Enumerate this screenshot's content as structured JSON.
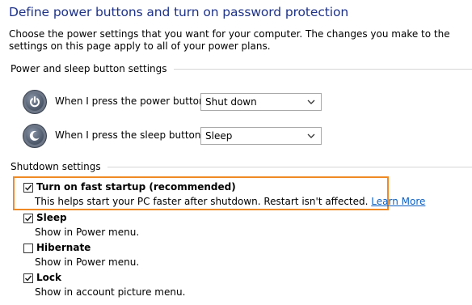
{
  "page": {
    "title": "Define power buttons and turn on password protection",
    "intro": "Choose the power settings that you want for your computer. The changes you make to the settings on this page apply to all of your power plans."
  },
  "power_section": {
    "header": "Power and sleep button settings",
    "rows": [
      {
        "label": "When I press the power button:",
        "value": "Shut down",
        "icon": "power-button-icon"
      },
      {
        "label": "When I press the sleep button:",
        "value": "Sleep",
        "icon": "sleep-button-icon"
      }
    ]
  },
  "shutdown_section": {
    "header": "Shutdown settings",
    "options": [
      {
        "title": "Turn on fast startup (recommended)",
        "description": "This helps start your PC faster after shutdown. Restart isn't affected.",
        "link": "Learn More",
        "checked": true
      },
      {
        "title": "Sleep",
        "description": "Show in Power menu.",
        "checked": true
      },
      {
        "title": "Hibernate",
        "description": "Show in Power menu.",
        "checked": false
      },
      {
        "title": "Lock",
        "description": "Show in account picture menu.",
        "checked": true
      }
    ]
  },
  "colors": {
    "title": "#1e3287",
    "highlight": "#f08a24",
    "link": "#0a5fc2"
  }
}
